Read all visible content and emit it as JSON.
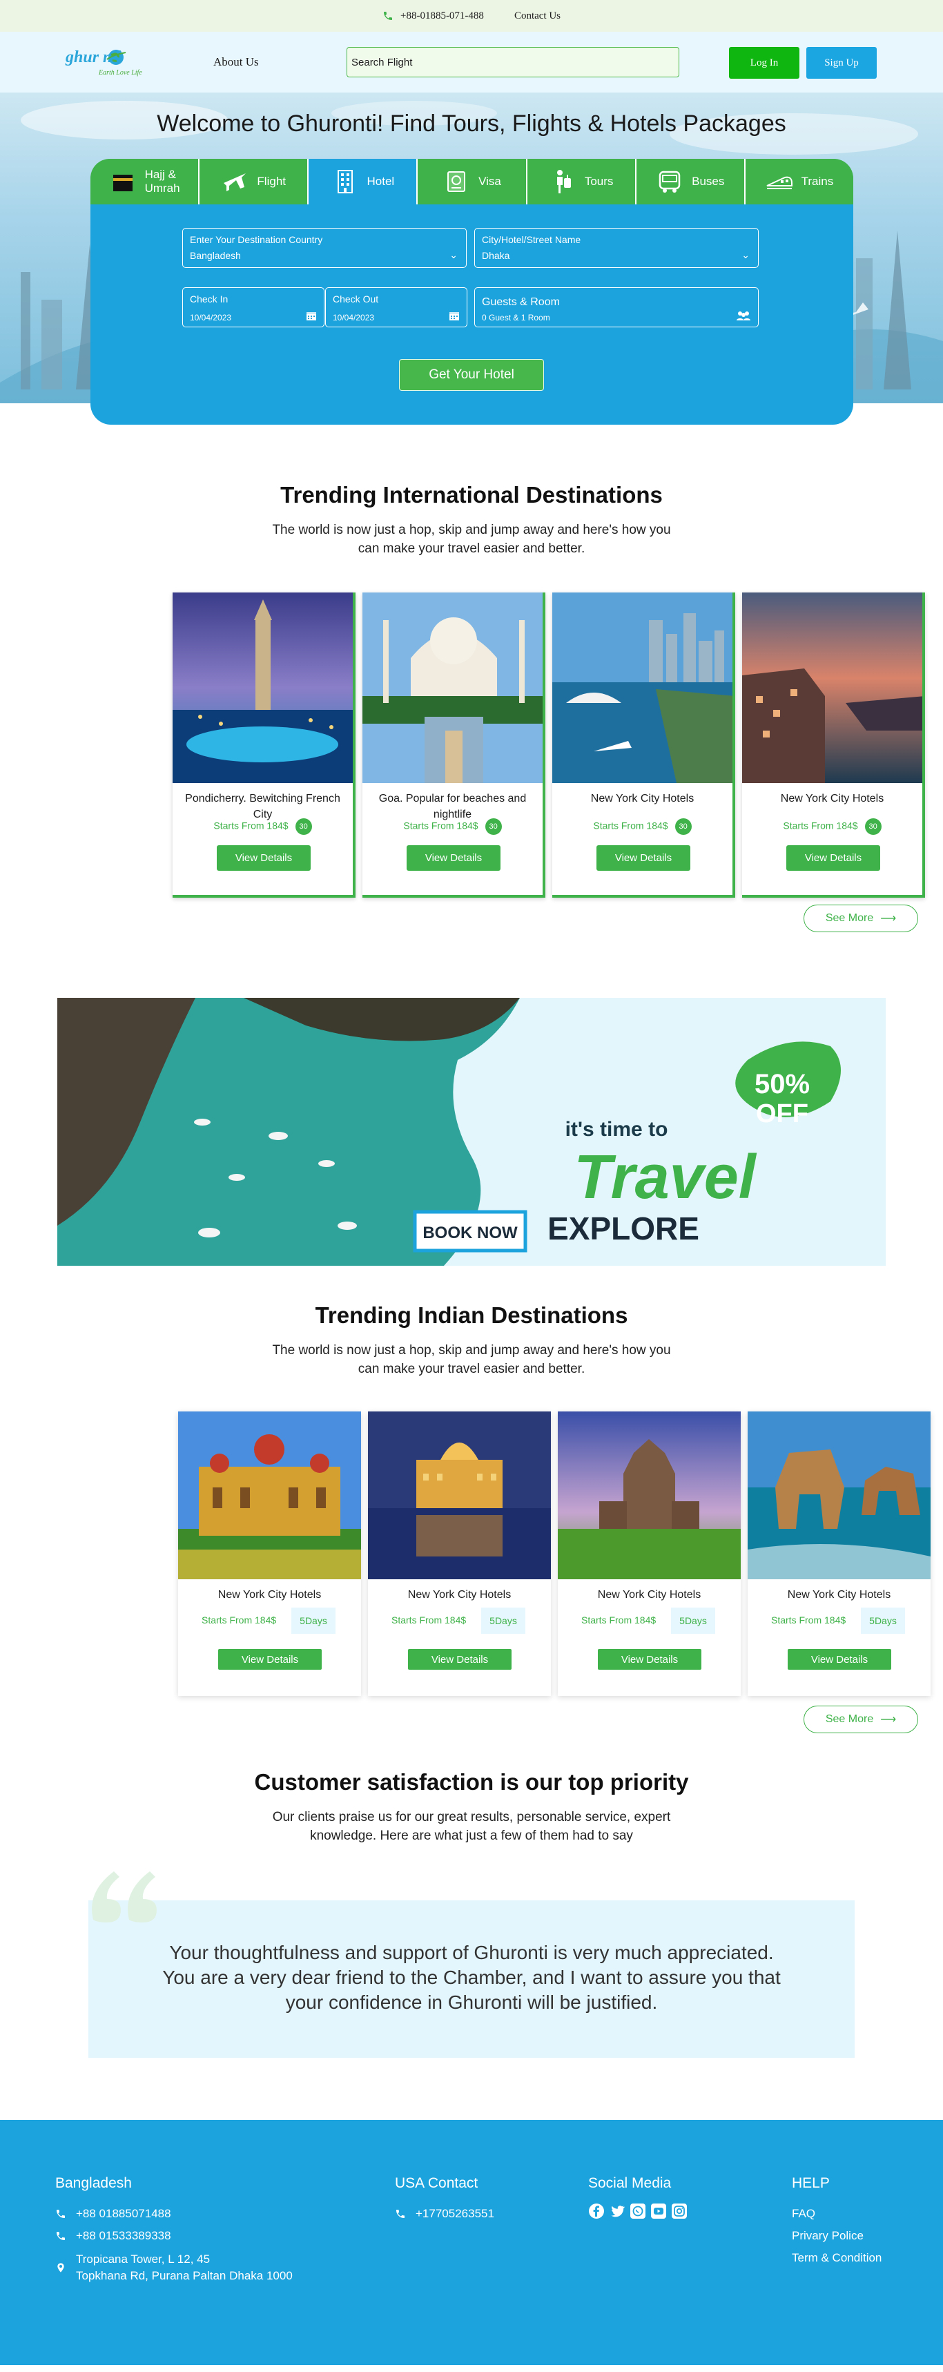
{
  "topbar": {
    "phone": "+88-01885-071-488",
    "contact": "Contact Us"
  },
  "header": {
    "logo_text": "ghur   nti",
    "logo_tagline": "Earth Love Life",
    "about": "About Us",
    "search_value": "Search Flight",
    "login": "Log In",
    "signup": "Sign Up"
  },
  "hero": {
    "title": "Welcome to Ghuronti! Find Tours, Flights & Hotels Packages",
    "tabs": [
      {
        "label": "Hajj &\nUmrah",
        "icon": "kaaba-icon"
      },
      {
        "label": "Flight",
        "icon": "airplane-icon"
      },
      {
        "label": "Hotel",
        "icon": "building-icon"
      },
      {
        "label": "Visa",
        "icon": "passport-icon"
      },
      {
        "label": "Tours",
        "icon": "traveler-icon"
      },
      {
        "label": "Buses",
        "icon": "bus-icon"
      },
      {
        "label": "Trains",
        "icon": "train-icon"
      }
    ],
    "destination_label": "Enter Your Destination Country",
    "destination_value": "Bangladesh",
    "city_label": "City/Hotel/Street Name",
    "city_value": "Dhaka",
    "checkin_label": "Check In",
    "checkin_value": "10/04/2023",
    "checkout_label": "Check Out",
    "checkout_value": "10/04/2023",
    "guests_label": "Guests & Room",
    "guests_value": "0 Guest & 1 Room",
    "submit": "Get Your Hotel"
  },
  "international": {
    "title": "Trending International Destinations",
    "subtitle_1": "The world is now just a hop, skip and jump away and here's how you",
    "subtitle_2": "can make your travel easier and better.",
    "cards": [
      {
        "name": "Pondicherry. Bewitching French City",
        "price": "Starts From 184$",
        "badge": "30",
        "button": "View Details"
      },
      {
        "name": "Goa. Popular for beaches and nightlife",
        "price": "Starts From 184$",
        "badge": "30",
        "button": "View Details"
      },
      {
        "name": "New York City Hotels",
        "price": "Starts From 184$",
        "badge": "30",
        "button": "View Details"
      },
      {
        "name": "New York City Hotels",
        "price": "Starts From 184$",
        "badge": "30",
        "button": "View Details"
      }
    ],
    "see_more": "See More"
  },
  "banner": {
    "tagline": "it's time to",
    "big": "Travel",
    "explore": "EXPLORE",
    "book": "BOOK NOW",
    "discount_1": "50%",
    "discount_2": "OFF"
  },
  "indian": {
    "title": "Trending Indian Destinations",
    "subtitle_1": "The world is now just a hop, skip and jump away and here's how you",
    "subtitle_2": "can make your travel easier and better.",
    "cards": [
      {
        "name": "New York City Hotels",
        "price": "Starts From 184$",
        "days": "5Days",
        "button": "View Details"
      },
      {
        "name": "New York City Hotels",
        "price": "Starts From 184$",
        "days": "5Days",
        "button": "View Details"
      },
      {
        "name": "New York City Hotels",
        "price": "Starts From 184$",
        "days": "5Days",
        "button": "View Details"
      },
      {
        "name": "New York City Hotels",
        "price": "Starts From 184$",
        "days": "5Days",
        "button": "View Details"
      }
    ],
    "see_more": "See More"
  },
  "satisfaction": {
    "title": "Customer satisfaction is our top priority",
    "subtitle_1": "Our clients praise us for our great results, personable service, expert",
    "subtitle_2": "knowledge. Here are what just a few of them had to say",
    "quote": "Your thoughtfulness and support of Ghuronti is very much appreciated. You are a very dear friend to the Chamber, and I want to assure you that your confidence in Ghuronti will be justified."
  },
  "footer": {
    "bd_title": "Bangladesh",
    "phone_1": "+88 01885071488",
    "phone_2": "+88 01533389338",
    "address_1": "Tropicana Tower, L 12, 45",
    "address_2": "Topkhana Rd, Purana Paltan Dhaka 1000",
    "usa_title": "USA Contact",
    "usa_phone": "+17705263551",
    "social_title": "Social Media",
    "social_icons": [
      "facebook-icon",
      "twitter-icon",
      "whatsapp-icon",
      "youtube-icon",
      "instagram-icon"
    ],
    "help_title": "HELP",
    "help_links": [
      "FAQ",
      "Privary Police",
      "Term & Condition"
    ]
  },
  "colors": {
    "green": "#3fb249",
    "blue": "#1ca2dc",
    "light_blue": "#e4f6fd"
  }
}
